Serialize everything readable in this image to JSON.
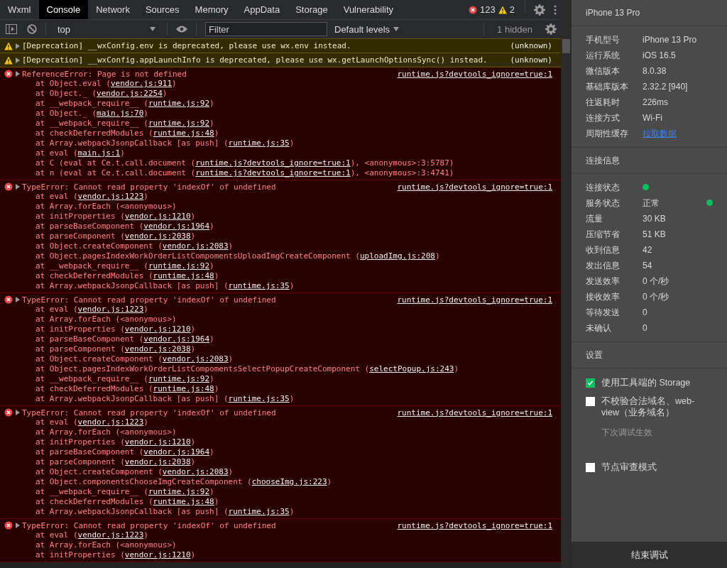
{
  "tabs": [
    {
      "label": "Wxml",
      "selected": false
    },
    {
      "label": "Console",
      "selected": true
    },
    {
      "label": "Network",
      "selected": false
    },
    {
      "label": "Sources",
      "selected": false
    },
    {
      "label": "Memory",
      "selected": false
    },
    {
      "label": "AppData",
      "selected": false
    },
    {
      "label": "Storage",
      "selected": false
    },
    {
      "label": "Vulnerability",
      "selected": false
    }
  ],
  "counts": {
    "errors": "123",
    "warnings": "2"
  },
  "toolbar": {
    "context": "top",
    "filter_placeholder": "Filter",
    "levels": "Default levels",
    "hidden": "1 hidden"
  },
  "messages": [
    {
      "kind": "warning",
      "text": "[Deprecation] __wxConfig.env is deprecated, please use wx.env instead.",
      "source": "(unknown)"
    },
    {
      "kind": "warning",
      "text": "[Deprecation] __wxConfig.appLaunchInfo is deprecated, please use wx.getLaunchOptionsSync() instead.",
      "source": "(unknown)"
    },
    {
      "kind": "error",
      "text": "ReferenceError: Page is not defined",
      "source": "runtime.js?devtools_ignore=true:1",
      "frames": [
        {
          "pre": "at Object.eval (",
          "link": "vendor.js:911",
          "post": ")"
        },
        {
          "pre": "at Object._ (",
          "link": "vendor.js:2254",
          "post": ")"
        },
        {
          "pre": "at __webpack_require__ (",
          "link": "runtime.js:92",
          "post": ")"
        },
        {
          "pre": "at Object._ (",
          "link": "main.js:70",
          "post": ")"
        },
        {
          "pre": "at __webpack_require__ (",
          "link": "runtime.js:92",
          "post": ")"
        },
        {
          "pre": "at checkDeferredModules (",
          "link": "runtime.js:48",
          "post": ")"
        },
        {
          "pre": "at Array.webpackJsonpCallback [as push] (",
          "link": "runtime.js:35",
          "post": ")"
        },
        {
          "pre": "at eval (",
          "link": "main.js:1",
          "post": ")"
        },
        {
          "pre": "at C (eval at Ce.t.call.document (",
          "link": "runtime.js?devtools_ignore=true:1",
          "post": "), <anonymous>:3:5787)"
        },
        {
          "pre": "at n (eval at Ce.t.call.document (",
          "link": "runtime.js?devtools_ignore=true:1",
          "post": "), <anonymous>:3:4741)"
        }
      ]
    },
    {
      "kind": "error",
      "text": "TypeError: Cannot read property 'indexOf' of undefined",
      "source": "runtime.js?devtools_ignore=true:1",
      "frames": [
        {
          "pre": "at eval (",
          "link": "vendor.js:1223",
          "post": ")"
        },
        {
          "pre": "at Array.forEach (<anonymous>)"
        },
        {
          "pre": "at initProperties (",
          "link": "vendor.js:1210",
          "post": ")"
        },
        {
          "pre": "at parseBaseComponent (",
          "link": "vendor.js:1964",
          "post": ")"
        },
        {
          "pre": "at parseComponent (",
          "link": "vendor.js:2038",
          "post": ")"
        },
        {
          "pre": "at Object.createComponent (",
          "link": "vendor.js:2083",
          "post": ")"
        },
        {
          "pre": "at Object.pagesIndexWorkOrderListCompomentsUploadImgCreateComponent (",
          "link": "uploadImg.js:208",
          "post": ")"
        },
        {
          "pre": "at __webpack_require__ (",
          "link": "runtime.js:92",
          "post": ")"
        },
        {
          "pre": "at checkDeferredModules (",
          "link": "runtime.js:48",
          "post": ")"
        },
        {
          "pre": "at Array.webpackJsonpCallback [as push] (",
          "link": "runtime.js:35",
          "post": ")"
        }
      ]
    },
    {
      "kind": "error",
      "text": "TypeError: Cannot read property 'indexOf' of undefined",
      "source": "runtime.js?devtools_ignore=true:1",
      "frames": [
        {
          "pre": "at eval (",
          "link": "vendor.js:1223",
          "post": ")"
        },
        {
          "pre": "at Array.forEach (<anonymous>)"
        },
        {
          "pre": "at initProperties (",
          "link": "vendor.js:1210",
          "post": ")"
        },
        {
          "pre": "at parseBaseComponent (",
          "link": "vendor.js:1964",
          "post": ")"
        },
        {
          "pre": "at parseComponent (",
          "link": "vendor.js:2038",
          "post": ")"
        },
        {
          "pre": "at Object.createComponent (",
          "link": "vendor.js:2083",
          "post": ")"
        },
        {
          "pre": "at Object.pagesIndexWorkOrderListCompomentsSelectPopupCreateComponent (",
          "link": "selectPopup.js:243",
          "post": ")"
        },
        {
          "pre": "at __webpack_require__ (",
          "link": "runtime.js:92",
          "post": ")"
        },
        {
          "pre": "at checkDeferredModules (",
          "link": "runtime.js:48",
          "post": ")"
        },
        {
          "pre": "at Array.webpackJsonpCallback [as push] (",
          "link": "runtime.js:35",
          "post": ")"
        }
      ]
    },
    {
      "kind": "error",
      "text": "TypeError: Cannot read property 'indexOf' of undefined",
      "source": "runtime.js?devtools_ignore=true:1",
      "frames": [
        {
          "pre": "at eval (",
          "link": "vendor.js:1223",
          "post": ")"
        },
        {
          "pre": "at Array.forEach (<anonymous>)"
        },
        {
          "pre": "at initProperties (",
          "link": "vendor.js:1210",
          "post": ")"
        },
        {
          "pre": "at parseBaseComponent (",
          "link": "vendor.js:1964",
          "post": ")"
        },
        {
          "pre": "at parseComponent (",
          "link": "vendor.js:2038",
          "post": ")"
        },
        {
          "pre": "at Object.createComponent (",
          "link": "vendor.js:2083",
          "post": ")"
        },
        {
          "pre": "at Object.componentsChooseImgCreateComponent (",
          "link": "chooseImg.js:223",
          "post": ")"
        },
        {
          "pre": "at __webpack_require__ (",
          "link": "runtime.js:92",
          "post": ")"
        },
        {
          "pre": "at checkDeferredModules (",
          "link": "runtime.js:48",
          "post": ")"
        },
        {
          "pre": "at Array.webpackJsonpCallback [as push] (",
          "link": "runtime.js:35",
          "post": ")"
        }
      ]
    },
    {
      "kind": "error",
      "text": "TypeError: Cannot read property 'indexOf' of undefined",
      "source": "runtime.js?devtools_ignore=true:1",
      "frames": [
        {
          "pre": "at eval (",
          "link": "vendor.js:1223",
          "post": ")"
        },
        {
          "pre": "at Array.forEach (<anonymous>)"
        },
        {
          "pre": "at initProperties (",
          "link": "vendor.js:1210",
          "post": ")"
        }
      ]
    }
  ],
  "device": {
    "title": "iPhone 13 Pro",
    "info": [
      {
        "label": "手机型号",
        "value": "iPhone 13 Pro",
        "kind": "text"
      },
      {
        "label": "运行系统",
        "value": "iOS 16.5",
        "kind": "text"
      },
      {
        "label": "微信版本",
        "value": "8.0.38",
        "kind": "text"
      },
      {
        "label": "基础库版本",
        "value": "2.32.2 [940]",
        "kind": "text"
      },
      {
        "label": "往返耗时",
        "value": "226ms",
        "kind": "text"
      },
      {
        "label": "连接方式",
        "value": "Wi-Fi",
        "kind": "text"
      },
      {
        "label": "周期性缓存",
        "value": "拉取数据",
        "kind": "link"
      }
    ]
  },
  "connection": {
    "title": "连接信息",
    "rows": [
      {
        "label": "连接状态",
        "kind": "dot",
        "color": "#07c160"
      },
      {
        "label": "服务状态",
        "value": "正常",
        "kind": "text-dot",
        "color": "#07c160"
      },
      {
        "label": "流量",
        "value": "30 KB",
        "kind": "text"
      },
      {
        "label": "压缩节省",
        "value": "51 KB",
        "kind": "text"
      },
      {
        "label": "收到信息",
        "value": "42",
        "kind": "text"
      },
      {
        "label": "发出信息",
        "value": "54",
        "kind": "text"
      },
      {
        "label": "发送效率",
        "value": "0 个/秒",
        "kind": "text"
      },
      {
        "label": "接收效率",
        "value": "0 个/秒",
        "kind": "text"
      },
      {
        "label": "等待发送",
        "value": "0",
        "kind": "text"
      },
      {
        "label": "未确认",
        "value": "0",
        "kind": "text"
      }
    ]
  },
  "settings": {
    "title": "设置",
    "options": [
      {
        "label": "使用工具端的 Storage",
        "checked": true
      },
      {
        "label": "不校验合法域名、web-view（业务域名）",
        "checked": false,
        "note": "下次调试生效"
      },
      {
        "label": "节点审查模式",
        "checked": false
      }
    ]
  },
  "end_button": "结束调试"
}
